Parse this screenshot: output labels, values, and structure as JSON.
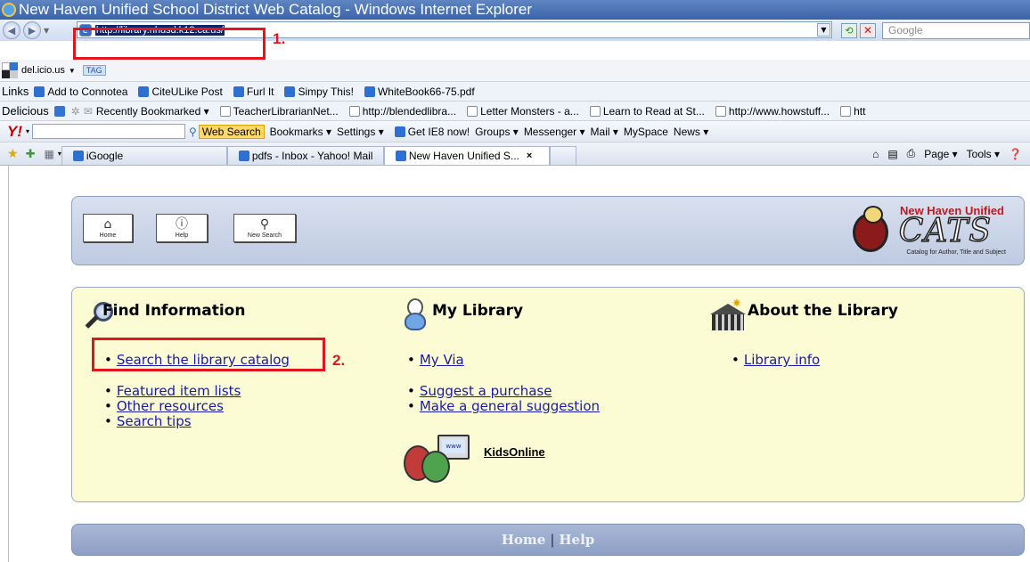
{
  "window": {
    "title": "New Haven Unified School District Web Catalog - Windows Internet Explorer"
  },
  "address": {
    "url": "http://library.nhusd.k12.ca.us/",
    "search_placeholder": "Google",
    "annotation_1": "1."
  },
  "toolbars": {
    "delicious_tag": {
      "label": "del.icio.us",
      "tag": "TAG"
    },
    "links": {
      "label": "Links",
      "items": [
        "Add to Connotea",
        "CiteULike Post",
        "Furl It",
        "Simpy This!",
        "WhiteBook66-75.pdf"
      ]
    },
    "delicious": {
      "label": "Delicious",
      "items": [
        "Recently Bookmarked ▾",
        "TeacherLibrarianNet...",
        "http://blendedlibra...",
        "Letter Monsters - a...",
        "Learn to Read at St...",
        "http://www.howstuff...",
        "htt"
      ]
    },
    "yahoo": {
      "logo": "Y!",
      "search_label": "Web Search",
      "items": [
        "Bookmarks ▾",
        "Settings ▾",
        "Get IE8 now!",
        "Groups ▾",
        "Messenger ▾",
        "Mail ▾",
        "MySpace",
        "News ▾"
      ]
    },
    "tabs": {
      "items": [
        "iGoogle",
        "pdfs - Inbox - Yahoo! Mail",
        "New Haven Unified S..."
      ],
      "close": "×",
      "right_items": [
        "Page ▾",
        "Tools ▾"
      ]
    }
  },
  "header": {
    "buttons": [
      {
        "icon": "home-icon",
        "label": "Home"
      },
      {
        "icon": "help-icon",
        "label": "Help"
      },
      {
        "icon": "new-search-icon",
        "label": "New Search"
      }
    ],
    "brand_top": "New Haven Unified",
    "brand_word": "CATS",
    "brand_sub": "Catalog for Author, Title and Subject"
  },
  "sections": {
    "find": {
      "title": "Find Information",
      "items": [
        "Search the library catalog",
        "Featured item lists",
        "Other resources",
        "Search tips"
      ],
      "annotation_2": "2."
    },
    "mylibrary": {
      "title": "My Library",
      "items": [
        "My Via",
        "Suggest a purchase",
        "Make a general suggestion"
      ]
    },
    "about": {
      "title": "About the Library",
      "items": [
        "Library info"
      ]
    },
    "kids": {
      "label": "KidsOnline",
      "screen_text": "www"
    }
  },
  "footer": {
    "home": "Home",
    "separator": "|",
    "help": "Help"
  },
  "colors": {
    "annotation_red": "#e3141b",
    "link_blue": "#1a1aa6",
    "panel_yellow": "#fbfbd4",
    "panel_blue": "#c6d0e6"
  }
}
